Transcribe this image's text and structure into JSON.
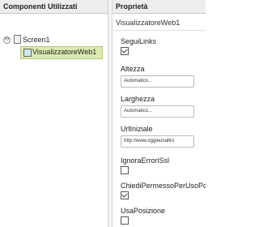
{
  "components": {
    "header": "Componenti Utilizzati",
    "tree": {
      "toggle": "⊖",
      "screen_label": "Screen1",
      "selected_label": "VisualizzatoreWeb1"
    }
  },
  "properties": {
    "header": "Proprietà",
    "component_name": "VisualizzatoreWeb1",
    "items": [
      {
        "label": "SeguiLinks",
        "type": "checkbox",
        "checked": true
      },
      {
        "label": "Altezza",
        "type": "text",
        "value": "Automatico..."
      },
      {
        "label": "Larghezza",
        "type": "text",
        "value": "Automatico..."
      },
      {
        "label": "UrlIniziale",
        "type": "text",
        "value": "http://www.oggieunaltro"
      },
      {
        "label": "IgnoraErroriSsl",
        "type": "checkbox",
        "checked": false
      },
      {
        "label": "ChiediPermessoPerUsoPosizione",
        "type": "checkbox",
        "checked": true
      },
      {
        "label": "UsaPosizione",
        "type": "checkbox",
        "checked": false
      }
    ]
  }
}
